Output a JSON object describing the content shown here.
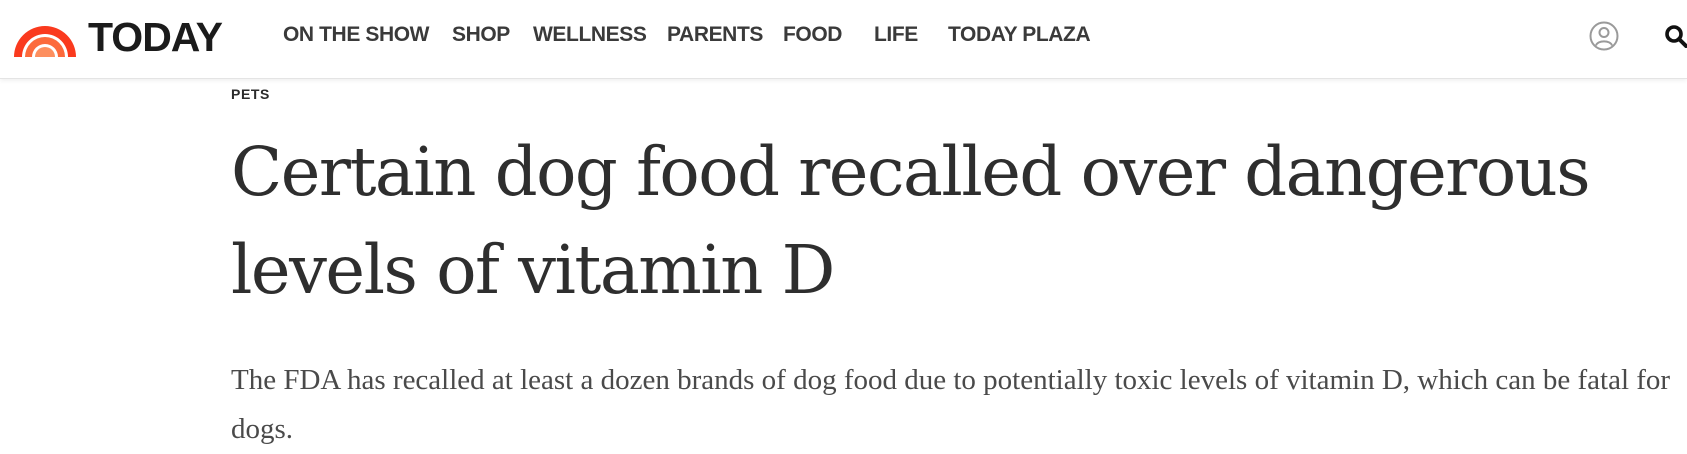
{
  "header": {
    "logo_text": "TODAY",
    "nav": [
      {
        "label": "ON THE SHOW",
        "name": "nav-on-the-show"
      },
      {
        "label": "SHOP",
        "name": "nav-shop"
      },
      {
        "label": "WELLNESS",
        "name": "nav-wellness"
      },
      {
        "label": "PARENTS",
        "name": "nav-parents"
      },
      {
        "label": "FOOD",
        "name": "nav-food"
      },
      {
        "label": "LIFE",
        "name": "nav-life"
      },
      {
        "label": "TODAY PLAZA",
        "name": "nav-today-plaza"
      }
    ],
    "icons": {
      "account": "user-account-icon",
      "search": "search-icon"
    }
  },
  "article": {
    "eyebrow": "PETS",
    "headline": "Certain dog food recalled over dangerous levels of vitamin D",
    "dek": "The FDA has recalled at least a dozen brands of dog food due to potentially toxic levels of vitamin D, which can be fatal for dogs."
  },
  "colors": {
    "brand_rays": [
      "#fa3a1e",
      "#fc6a3c",
      "#fd8f5f"
    ],
    "logo_text": "#1b1b1b",
    "nav_text": "#3a3a3a",
    "headline": "#2e2e2e",
    "body_text": "#4a4a4a"
  }
}
